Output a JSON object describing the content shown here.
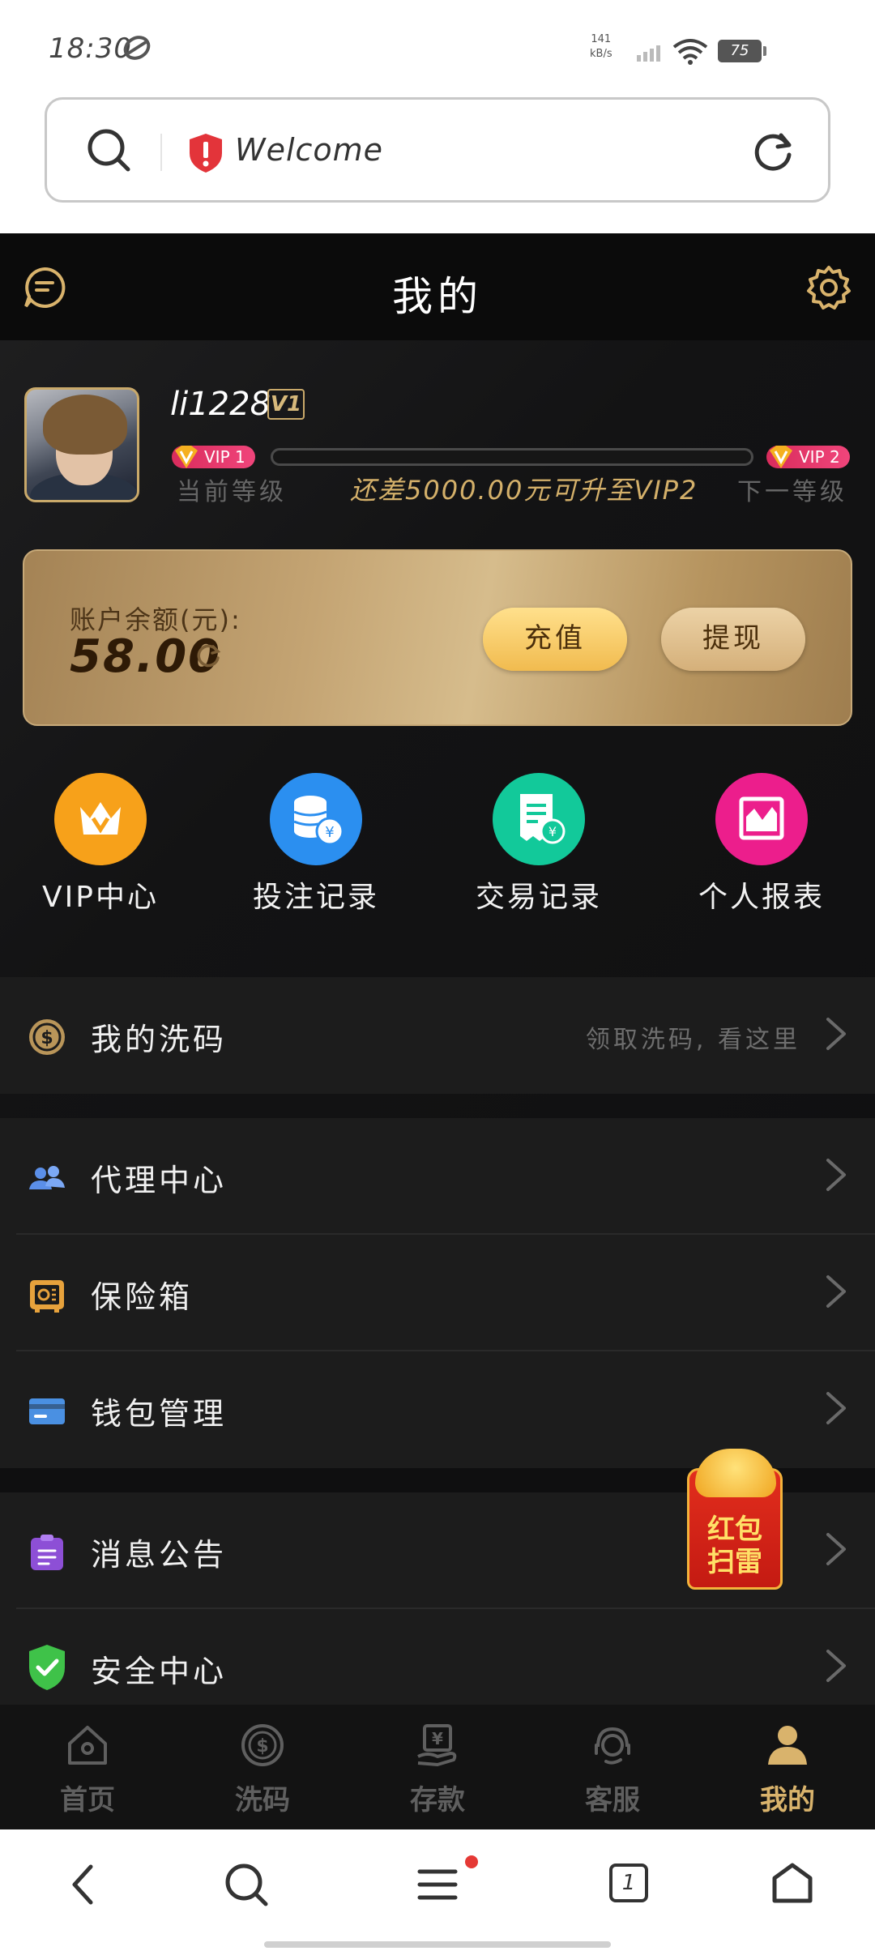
{
  "status": {
    "time": "18:30",
    "speed_value": "141",
    "speed_unit": "kB/s",
    "battery": "75"
  },
  "browser": {
    "url_text": "Welcome"
  },
  "header": {
    "title": "我的"
  },
  "profile": {
    "username": "li1228",
    "vip_badge": "V1",
    "current_vip": "VIP 1",
    "next_vip": "VIP 2",
    "current_level_label": "当前等级",
    "next_level_label": "下一等级",
    "upgrade_text": "还差5000.00元可升至VIP2",
    "progress": 0.0
  },
  "balance": {
    "label": "账户余额(元):",
    "amount": "58.00",
    "recharge_label": "充值",
    "withdraw_label": "提现"
  },
  "shortcuts": [
    {
      "label": "VIP中心",
      "icon": "vip-crown-icon",
      "color": "#f7a11a"
    },
    {
      "label": "投注记录",
      "icon": "coins-icon",
      "color": "#2b8ff0"
    },
    {
      "label": "交易记录",
      "icon": "receipt-icon",
      "color": "#12c99a"
    },
    {
      "label": "个人报表",
      "icon": "report-chart-icon",
      "color": "#ec1e8c"
    }
  ],
  "menu": {
    "wash": {
      "label": "我的洗码",
      "hint": "领取洗码, 看这里"
    },
    "agent": {
      "label": "代理中心"
    },
    "safe": {
      "label": "保险箱"
    },
    "wallet": {
      "label": "钱包管理"
    },
    "notice": {
      "label": "消息公告"
    },
    "security": {
      "label": "安全中心"
    }
  },
  "red_packet": {
    "line1": "红包",
    "line2": "扫雷"
  },
  "tabs": [
    {
      "label": "首页",
      "icon": "home-icon"
    },
    {
      "label": "洗码",
      "icon": "wash-coin-icon"
    },
    {
      "label": "存款",
      "icon": "deposit-icon"
    },
    {
      "label": "客服",
      "icon": "support-icon"
    },
    {
      "label": "我的",
      "icon": "profile-icon",
      "active": true
    }
  ],
  "navbar": {
    "tab_count": "1"
  },
  "colors": {
    "gold": "#d9b36c",
    "background": "#0f0f10",
    "vip_pink": "#e83369"
  }
}
